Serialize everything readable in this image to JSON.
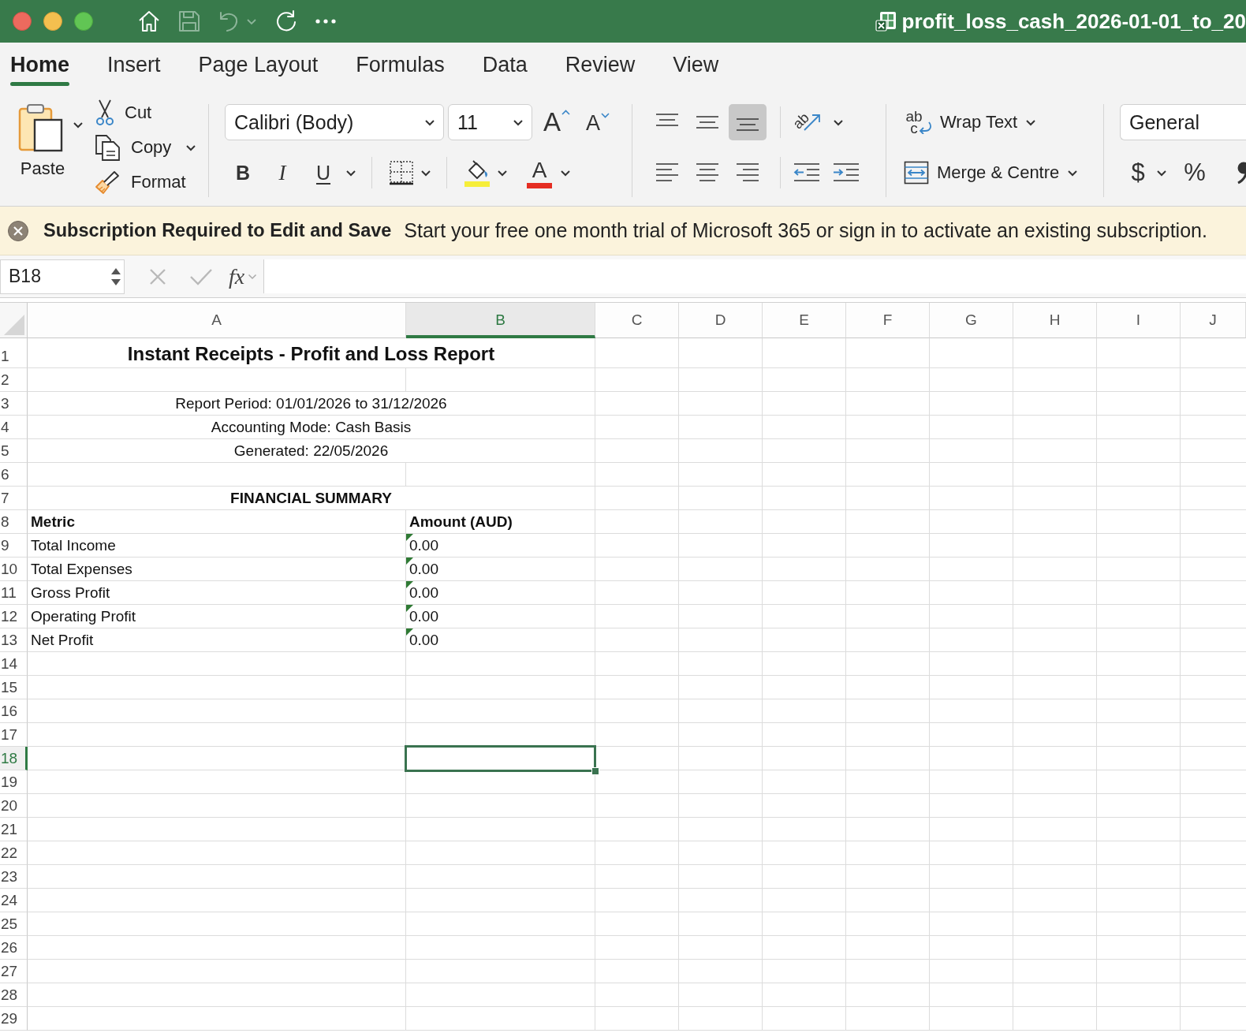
{
  "title_bar": {
    "tools": [
      {
        "kind": "home",
        "disabled": false
      },
      {
        "kind": "save",
        "disabled": true
      },
      {
        "kind": "undo",
        "disabled": true
      },
      {
        "kind": "redo",
        "disabled": false
      },
      {
        "kind": "more",
        "disabled": false
      }
    ],
    "file_name": "profit_loss_cash_2026-01-01_to_20"
  },
  "tabs": [
    {
      "label": "Home",
      "selected": true
    },
    {
      "label": "Insert",
      "selected": false
    },
    {
      "label": "Page Layout",
      "selected": false
    },
    {
      "label": "Formulas",
      "selected": false
    },
    {
      "label": "Data",
      "selected": false
    },
    {
      "label": "Review",
      "selected": false
    },
    {
      "label": "View",
      "selected": false
    }
  ],
  "ribbon": {
    "clipboard": {
      "paste": "Paste",
      "cut": "Cut",
      "copy": "Copy",
      "format": "Format"
    },
    "font": {
      "family": "Calibri (Body)",
      "size": "11",
      "grow": "A",
      "shrink": "A",
      "styles": [
        {
          "kind": "bold",
          "label": "B"
        },
        {
          "kind": "italic",
          "label": "I"
        },
        {
          "kind": "underline",
          "label": "U"
        }
      ],
      "font_color": "A"
    },
    "alignment": {
      "vertical": [
        {
          "kind": "top",
          "selected": false
        },
        {
          "kind": "middle",
          "selected": false
        },
        {
          "kind": "bottom",
          "selected": true
        }
      ],
      "horizontal": [
        {
          "kind": "left",
          "selected": false
        },
        {
          "kind": "center",
          "selected": false
        },
        {
          "kind": "right",
          "selected": false
        }
      ],
      "orientation": "ab",
      "wrap_icon": {
        "top": "ab",
        "bottom": "c"
      },
      "wrap_text": "Wrap Text",
      "merge": "Merge & Centre"
    },
    "number": {
      "format": "General",
      "currency": "$",
      "percent": "%"
    }
  },
  "notice": {
    "title": "Subscription Required to Edit and Save",
    "message": "Start your free one month trial of Microsoft 365 or sign in to activate an existing subscription."
  },
  "formula_bar": {
    "name_box": "B18",
    "edit_buttons": [
      {
        "kind": "cancel",
        "disabled": true
      },
      {
        "kind": "enter",
        "disabled": true
      }
    ],
    "function_label": "fx"
  },
  "sheet": {
    "columns": [
      {
        "label": "A",
        "selected": false
      },
      {
        "label": "B",
        "selected": true
      },
      {
        "label": "C",
        "selected": false
      },
      {
        "label": "D",
        "selected": false
      },
      {
        "label": "E",
        "selected": false
      },
      {
        "label": "F",
        "selected": false
      },
      {
        "label": "G",
        "selected": false
      },
      {
        "label": "H",
        "selected": false
      },
      {
        "label": "I",
        "selected": false
      },
      {
        "label": "J",
        "selected": false
      }
    ],
    "rows": [
      {
        "number": "1",
        "kind": "title",
        "text": "Instant Receipts - Profit and Loss Report",
        "selected": false
      },
      {
        "number": "2",
        "kind": "empty",
        "selected": false
      },
      {
        "number": "3",
        "kind": "merged",
        "text": "Report Period: 01/01/2026 to 31/12/2026",
        "selected": false
      },
      {
        "number": "4",
        "kind": "merged",
        "text": "Accounting Mode: Cash Basis",
        "selected": false
      },
      {
        "number": "5",
        "kind": "merged",
        "text": "Generated: 22/05/2026",
        "selected": false
      },
      {
        "number": "6",
        "kind": "empty",
        "selected": false
      },
      {
        "number": "7",
        "kind": "section",
        "text": "FINANCIAL SUMMARY",
        "selected": false
      },
      {
        "number": "8",
        "kind": "header",
        "metric": "Metric",
        "amount": "Amount (AUD)",
        "selected": false
      },
      {
        "number": "9",
        "kind": "data",
        "metric": "Total Income",
        "amount": "0.00",
        "flagged": true,
        "selected": false
      },
      {
        "number": "10",
        "kind": "data",
        "metric": "Total Expenses",
        "amount": "0.00",
        "flagged": true,
        "selected": false
      },
      {
        "number": "11",
        "kind": "data",
        "metric": "Gross Profit",
        "amount": "0.00",
        "flagged": true,
        "selected": false
      },
      {
        "number": "12",
        "kind": "data",
        "metric": "Operating Profit",
        "amount": "0.00",
        "flagged": true,
        "selected": false
      },
      {
        "number": "13",
        "kind": "data",
        "metric": "Net Profit",
        "amount": "0.00",
        "flagged": true,
        "selected": false
      },
      {
        "number": "14",
        "kind": "empty",
        "selected": false
      },
      {
        "number": "15",
        "kind": "empty",
        "selected": false
      },
      {
        "number": "16",
        "kind": "empty",
        "selected": false
      },
      {
        "number": "17",
        "kind": "empty",
        "selected": false
      },
      {
        "number": "18",
        "kind": "empty",
        "selected": true
      },
      {
        "number": "19",
        "kind": "empty",
        "selected": false
      },
      {
        "number": "20",
        "kind": "empty",
        "selected": false
      },
      {
        "number": "21",
        "kind": "empty",
        "selected": false
      },
      {
        "number": "22",
        "kind": "empty",
        "selected": false
      },
      {
        "number": "23",
        "kind": "empty",
        "selected": false
      },
      {
        "number": "24",
        "kind": "empty",
        "selected": false
      },
      {
        "number": "25",
        "kind": "empty",
        "selected": false
      },
      {
        "number": "26",
        "kind": "empty",
        "selected": false
      },
      {
        "number": "27",
        "kind": "empty",
        "selected": false
      },
      {
        "number": "28",
        "kind": "empty",
        "selected": false
      },
      {
        "number": "29",
        "kind": "empty",
        "selected": false
      }
    ]
  }
}
